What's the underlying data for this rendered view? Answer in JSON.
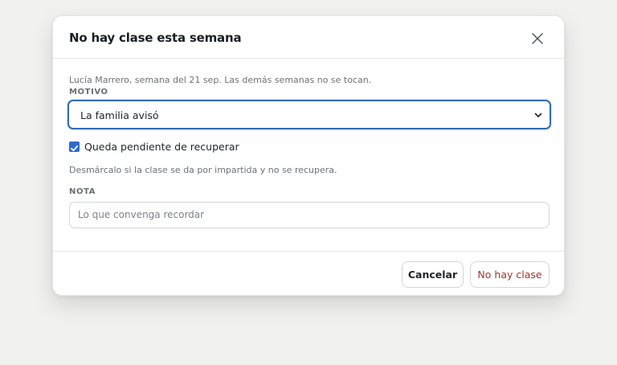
{
  "dialog": {
    "title": "No hay clase esta semana",
    "close_icon": "close-icon",
    "subtitle": "Lucía Marrero, semana del 21 sep. Las demás semanas no se tocan.",
    "motivo": {
      "label": "MOTIVO",
      "selected": "La familia avisó"
    },
    "pending": {
      "checked": true,
      "label": "Queda pendiente de recuperar",
      "hint": "Desmárcalo si la clase se da por impartida y no se recupera."
    },
    "nota": {
      "label": "NOTA",
      "placeholder": "Lo que convenga recordar",
      "value": ""
    },
    "buttons": {
      "cancel": "Cancelar",
      "confirm": "No hay clase"
    }
  },
  "colors": {
    "accent": "#2c6bd1",
    "danger_text": "#a3362a",
    "background": "#f1f2ef"
  }
}
